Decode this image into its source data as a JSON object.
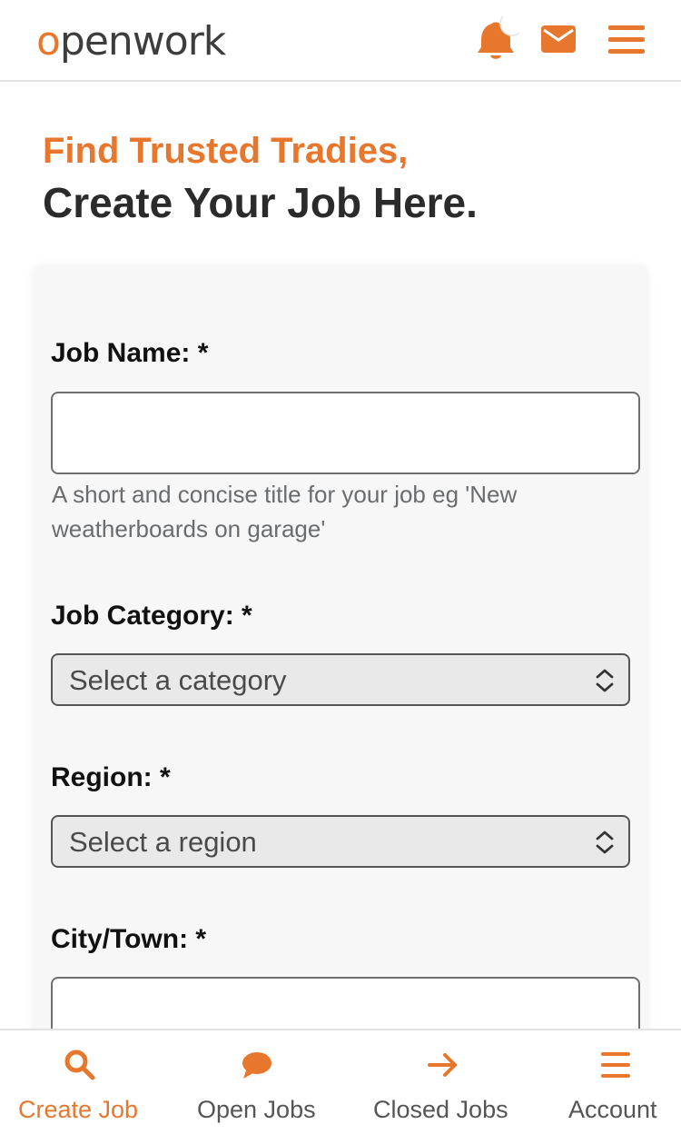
{
  "header": {
    "logo_first": "o",
    "logo_rest": "penwork",
    "icons": [
      "bell-icon",
      "mail-icon",
      "hamburger-menu-icon"
    ]
  },
  "hero": {
    "line1": "Find Trusted Tradies,",
    "line2": "Create Your Job Here."
  },
  "form": {
    "job_name_label": "Job Name: *",
    "job_name_value": "",
    "job_name_help": "A short and concise title for your job eg 'New weatherboards on garage'",
    "category_label": "Job Category: *",
    "category_value": "Select a category",
    "region_label": "Region: *",
    "region_value": "Select a region",
    "city_label": "City/Town: *",
    "city_value": ""
  },
  "bottom_nav": {
    "items": [
      {
        "label": "Create Job",
        "icon": "search-icon",
        "active": true
      },
      {
        "label": "Open Jobs",
        "icon": "chat-bubble-icon",
        "active": false
      },
      {
        "label": "Closed Jobs",
        "icon": "arrow-right-icon",
        "active": false
      },
      {
        "label": "Account",
        "icon": "hamburger-menu-icon",
        "active": false
      }
    ]
  },
  "colors": {
    "accent": "#e8772e",
    "text_dark": "#2b2b2b",
    "helper_text": "#6a6d70"
  }
}
